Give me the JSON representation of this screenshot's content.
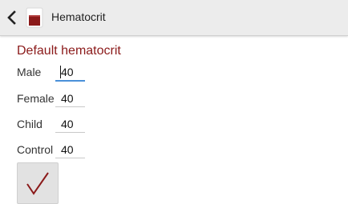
{
  "header": {
    "title": "Hematocrit",
    "back_icon": "chevron-left-icon",
    "app_icon": "blood-tube-icon",
    "app_icon_color": "#8b1a1a"
  },
  "main": {
    "section_title": "Default hematocrit",
    "section_title_color": "#8b1a1a",
    "fields": [
      {
        "label": "Male",
        "value": "40"
      },
      {
        "label": "Female",
        "value": "40"
      },
      {
        "label": "Child",
        "value": "40"
      },
      {
        "label": "Control",
        "value": "40"
      }
    ],
    "confirm_icon": "checkmark-icon",
    "confirm_icon_color": "#8b1a1a"
  }
}
